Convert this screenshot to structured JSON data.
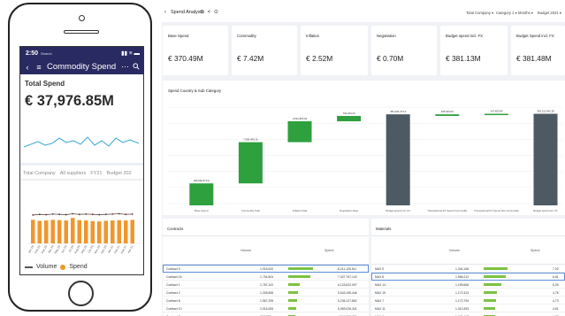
{
  "mobile": {
    "status": {
      "time": "2:50",
      "carrier": "Search",
      "icons": "▮▮ ≡ ▬"
    },
    "header": {
      "back_icon": "chevron-left-icon",
      "menu_icon": "menu-icon",
      "title": "Commodity Spend",
      "more": "⋯",
      "search_icon": "search-icon"
    },
    "total_spend": {
      "label": "Total Spend",
      "value": "€ 37,976.85M"
    },
    "filters": [
      "Total Company",
      "All suppliers",
      "FY21",
      "Budget 202"
    ],
    "chart_data": {
      "type": "bar",
      "series": [
        {
          "name": "Volume",
          "type": "line",
          "values": [
            0.78,
            0.8,
            0.79,
            0.81,
            0.8,
            0.79,
            0.82,
            0.8,
            0.81,
            0.8,
            0.79,
            0.8,
            0.81,
            0.82,
            0.8,
            0.81
          ]
        },
        {
          "name": "Spend",
          "type": "bar",
          "values": [
            0.74,
            0.71,
            0.72,
            0.74,
            0.73,
            0.72,
            0.8,
            0.73,
            0.72,
            0.7,
            0.69,
            0.71,
            0.72,
            0.73,
            0.72,
            0.74
          ]
        }
      ],
      "categories": [
        "Jan 20",
        "Feb 20",
        "Mar 20",
        "Apr 20",
        "May 20",
        "Jun 20",
        "Jul 20",
        "Aug 20",
        "Sep 20",
        "Oct 20",
        "Nov 20",
        "Dec 20",
        "Jan 21",
        "Feb 21",
        "Mar 21",
        "Apr 21"
      ],
      "colors": {
        "Spend": "#f0962d",
        "Volume": "#555555"
      }
    },
    "legend": {
      "volume": "Volume",
      "spend": "Spend"
    }
  },
  "dashboard": {
    "title": "Spend Analysis",
    "tools": "⊙ < ⊙",
    "filters": [
      "Total Company ▾",
      "Category 1 ▾",
      "Months ▾",
      "Budget 2021 ▾"
    ],
    "kpis": [
      {
        "label": "Base Spend",
        "value": "€ 370.49M"
      },
      {
        "label": "Commodity",
        "value": "€ 7.42M"
      },
      {
        "label": "Inflation",
        "value": "€ 2.52M"
      },
      {
        "label": "Negotiation",
        "value": "€ 0.70M"
      },
      {
        "label": "Budget spend incl. FX",
        "value": "€ 381.13M"
      },
      {
        "label": "Budget Spend incl. FX",
        "value": "€ 381.48M"
      }
    ],
    "waterfall": {
      "title": "Spend Country & Sub Category",
      "chart_data": {
        "type": "bar",
        "categories": [
          "Base Spend",
          "Commodity Total",
          "Inflation Data",
          "Negotiation Data",
          "Budget spend incl. FX",
          "Transactional FX Spend Commodity",
          "Transactional FX Spend Non Commodity",
          "Budget spend incl. FX"
        ],
        "steps": [
          {
            "label": "205,062,572.6",
            "base": 0,
            "value": 0.205,
            "kind": "up"
          },
          {
            "label": "7,395,469.16",
            "base": 0.205,
            "value": 0.385,
            "kind": "up"
          },
          {
            "label": "2,521,826.94",
            "base": 0.59,
            "value": 0.195,
            "kind": "up"
          },
          {
            "label": "704,234.23",
            "base": 0.785,
            "value": 0.05,
            "kind": "up"
          },
          {
            "label": "381,024,474.4",
            "base": 0,
            "value": 0.85,
            "kind": "total"
          },
          {
            "label": "205,633.00",
            "base": 0.835,
            "value": 0.015,
            "kind": "up"
          },
          {
            "label": "147,453.80",
            "base": 0.85,
            "value": 0.005,
            "kind": "up"
          },
          {
            "label": "381,212,942.28",
            "base": 0,
            "value": 0.855,
            "kind": "total"
          }
        ],
        "colors": {
          "up": "#2ea03e",
          "total": "#4d5a63"
        }
      }
    },
    "contracts": {
      "title": "Contracts",
      "columns": [
        "Volume",
        "Spend"
      ],
      "rows": [
        {
          "name": "Contract 9",
          "volume": "1,915,000",
          "spend": "8,211,125,511",
          "pct": 1.0,
          "selected": true
        },
        {
          "name": "Contract 16",
          "volume": "1,794,504",
          "spend": "7,327,767,143",
          "pct": 0.89,
          "selected": false
        },
        {
          "name": "Contract 1",
          "volume": "1,787,102",
          "spend": "6,123,622,097",
          "pct": 0.45,
          "selected": false
        },
        {
          "name": "Contract 2",
          "volume": "1,326,665",
          "spend": "5,643,195,446",
          "pct": 0.38,
          "selected": false
        },
        {
          "name": "Contract 8",
          "volume": "1,567,295",
          "spend": "5,236,127,852",
          "pct": 0.34,
          "selected": false
        },
        {
          "name": "Contract 10",
          "volume": "2,016,083",
          "spend": "5,069,026,341",
          "pct": 0.32,
          "selected": false
        },
        {
          "name": "Contract 7",
          "volume": "998,822",
          "spend": "4,744,090,776",
          "pct": 0.29,
          "selected": false
        }
      ]
    },
    "materials": {
      "title": "Materials",
      "columns": [
        "Volume",
        "Spend"
      ],
      "rows": [
        {
          "name": "MAX 9",
          "volume": "1,344,166",
          "spend": "7,02",
          "pct": 0.95,
          "selected": false
        },
        {
          "name": "MAX 8",
          "volume": "1,966,212",
          "spend": "6,81",
          "pct": 0.9,
          "selected": true
        },
        {
          "name": "MAX 14",
          "volume": "1,159,666",
          "spend": "6,05",
          "pct": 0.72,
          "selected": false
        },
        {
          "name": "MAX 15",
          "volume": "1,172,313",
          "spend": "4,76",
          "pct": 0.55,
          "selected": false
        },
        {
          "name": "MAX 7",
          "volume": "1,172,794",
          "spend": "4,73",
          "pct": 0.5,
          "selected": false
        },
        {
          "name": "MAX 11",
          "volume": "1,310,353",
          "spend": "4,61",
          "pct": 0.48,
          "selected": false
        },
        {
          "name": "MAX 2",
          "volume": "1,062,417",
          "spend": "4,57",
          "pct": 0.46,
          "selected": false
        }
      ]
    }
  }
}
